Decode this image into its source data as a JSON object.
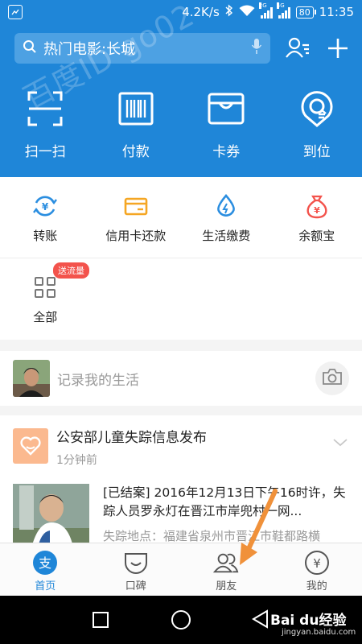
{
  "status_bar": {
    "speed": "4.2K/s",
    "sim1_tag": "2G",
    "sim2_tag": "4G",
    "battery": "80",
    "time": "11:35"
  },
  "header": {
    "search_placeholder": "热门电影:长城",
    "quick_actions": [
      {
        "label": "扫一扫",
        "icon": "scan-icon"
      },
      {
        "label": "付款",
        "icon": "barcode-icon"
      },
      {
        "label": "卡券",
        "icon": "wallet-icon"
      },
      {
        "label": "到位",
        "icon": "location-pin-icon"
      }
    ],
    "watermark": "百度ID go02"
  },
  "services": {
    "items": [
      {
        "label": "转账",
        "icon": "transfer-icon",
        "color": "#2b8ee0"
      },
      {
        "label": "信用卡还款",
        "icon": "credit-card-icon",
        "color": "#f5a623"
      },
      {
        "label": "生活缴费",
        "icon": "water-drop-icon",
        "color": "#2b8ee0"
      },
      {
        "label": "余额宝",
        "icon": "money-bag-icon",
        "color": "#f3534c"
      }
    ],
    "all": {
      "label": "全部",
      "icon": "grid-icon",
      "badge": "送流量"
    }
  },
  "record": {
    "placeholder": "记录我的生活"
  },
  "news_card": {
    "title": "公安部儿童失踪信息发布",
    "time": "1分钟前",
    "description": "[已结案] 2016年12月13日下午16时许，失踪人员罗永灯在晋江市岸兜村一网...",
    "location": "失踪地点：福建省泉州市晋江市鞋都路横"
  },
  "tabbar": {
    "tabs": [
      {
        "label": "首页",
        "icon": "home-icon",
        "active": true
      },
      {
        "label": "口碑",
        "icon": "koubei-icon",
        "active": false
      },
      {
        "label": "朋友",
        "icon": "friends-icon",
        "active": false
      },
      {
        "label": "我的",
        "icon": "yuan-icon",
        "active": false
      }
    ]
  },
  "colors": {
    "brand_blue": "#1f86d8",
    "badge_red": "#f3534c",
    "arrow_orange": "#f0913a"
  },
  "baidu_watermark": {
    "brand": "Bai du经验",
    "url": "jingyan.baidu.com"
  }
}
